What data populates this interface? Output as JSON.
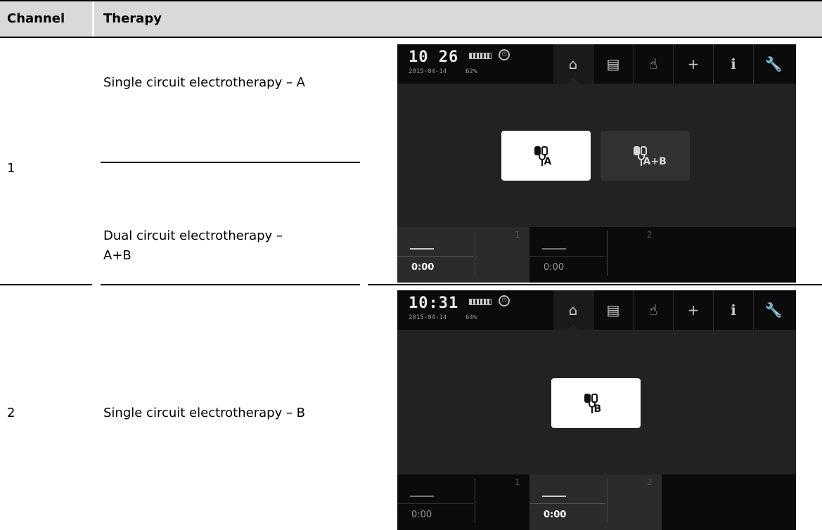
{
  "table": {
    "headers": [
      "Channel",
      "Therapy"
    ],
    "rows": [
      {
        "channel": "1",
        "therapies": [
          "Single circuit electrotherapy – A",
          "Dual circuit electrotherapy – A+B"
        ]
      },
      {
        "channel": "2",
        "therapies": [
          "Single circuit electrotherapy – B"
        ]
      }
    ]
  },
  "screens": [
    {
      "time": "10 26",
      "date": "2015-04-14",
      "battery_percent": "62%",
      "nav_icons": [
        "home-icon",
        "document-icon",
        "hand-icon",
        "plus-icon",
        "info-icon",
        "wrench-icon"
      ],
      "active_tab": "home-icon",
      "buttons": [
        {
          "label": "A",
          "selected": true
        },
        {
          "label": "A+B",
          "selected": false
        }
      ],
      "channels": [
        {
          "number": "1",
          "time": "0:00",
          "highlighted": true
        },
        {
          "number": "2",
          "time": "0:00",
          "highlighted": false
        }
      ]
    },
    {
      "time": "10:31",
      "date": "2015-04-14",
      "battery_percent": "64%",
      "nav_icons": [
        "home-icon",
        "document-icon",
        "hand-icon",
        "plus-icon",
        "info-icon",
        "wrench-icon"
      ],
      "active_tab": "home-icon",
      "buttons": [
        {
          "label": "B",
          "selected": true
        }
      ],
      "channels": [
        {
          "number": "1",
          "time": "0:00",
          "highlighted": false
        },
        {
          "number": "2",
          "time": "0:00",
          "highlighted": true
        }
      ]
    }
  ],
  "colors": {
    "header_bg": "#d9d9d9",
    "screen_bg": "#222222",
    "topbar_bg": "#0b0b0b",
    "button_selected": "#ffffff",
    "button_unselected": "#323232"
  }
}
